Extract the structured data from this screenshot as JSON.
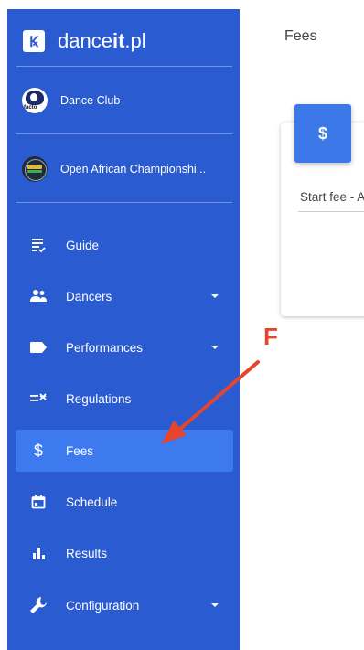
{
  "brand": {
    "name_regular": "dance",
    "name_bold": "it",
    "name_suffix": ".pl",
    "logo_glyph": "Ꝃ"
  },
  "accounts": [
    {
      "name": "Dance Club",
      "avatar_text": "facto"
    },
    {
      "name": "Open African Championshi..."
    }
  ],
  "nav": {
    "items": [
      {
        "label": "Guide",
        "icon": "guide-list-icon"
      },
      {
        "label": "Dancers",
        "icon": "people-icon",
        "has_submenu": true
      },
      {
        "label": "Performances",
        "icon": "label-tag-icon",
        "has_submenu": true
      },
      {
        "label": "Regulations",
        "icon": "regulations-icon"
      },
      {
        "label": "Fees",
        "icon": "dollar-icon",
        "active": true
      },
      {
        "label": "Schedule",
        "icon": "calendar-icon"
      },
      {
        "label": "Results",
        "icon": "bar-chart-icon"
      },
      {
        "label": "Configuration",
        "icon": "wrench-icon",
        "has_submenu": true
      }
    ]
  },
  "header": {
    "title": "Fees"
  },
  "card": {
    "badge_glyph": "$",
    "text": "Start fee - A"
  },
  "annotation": {
    "letter": "F",
    "color": "#e5452d"
  },
  "colors": {
    "sidebar": "#2a5bd0",
    "active_item": "#3d7af0",
    "badge": "#3d78e8"
  }
}
